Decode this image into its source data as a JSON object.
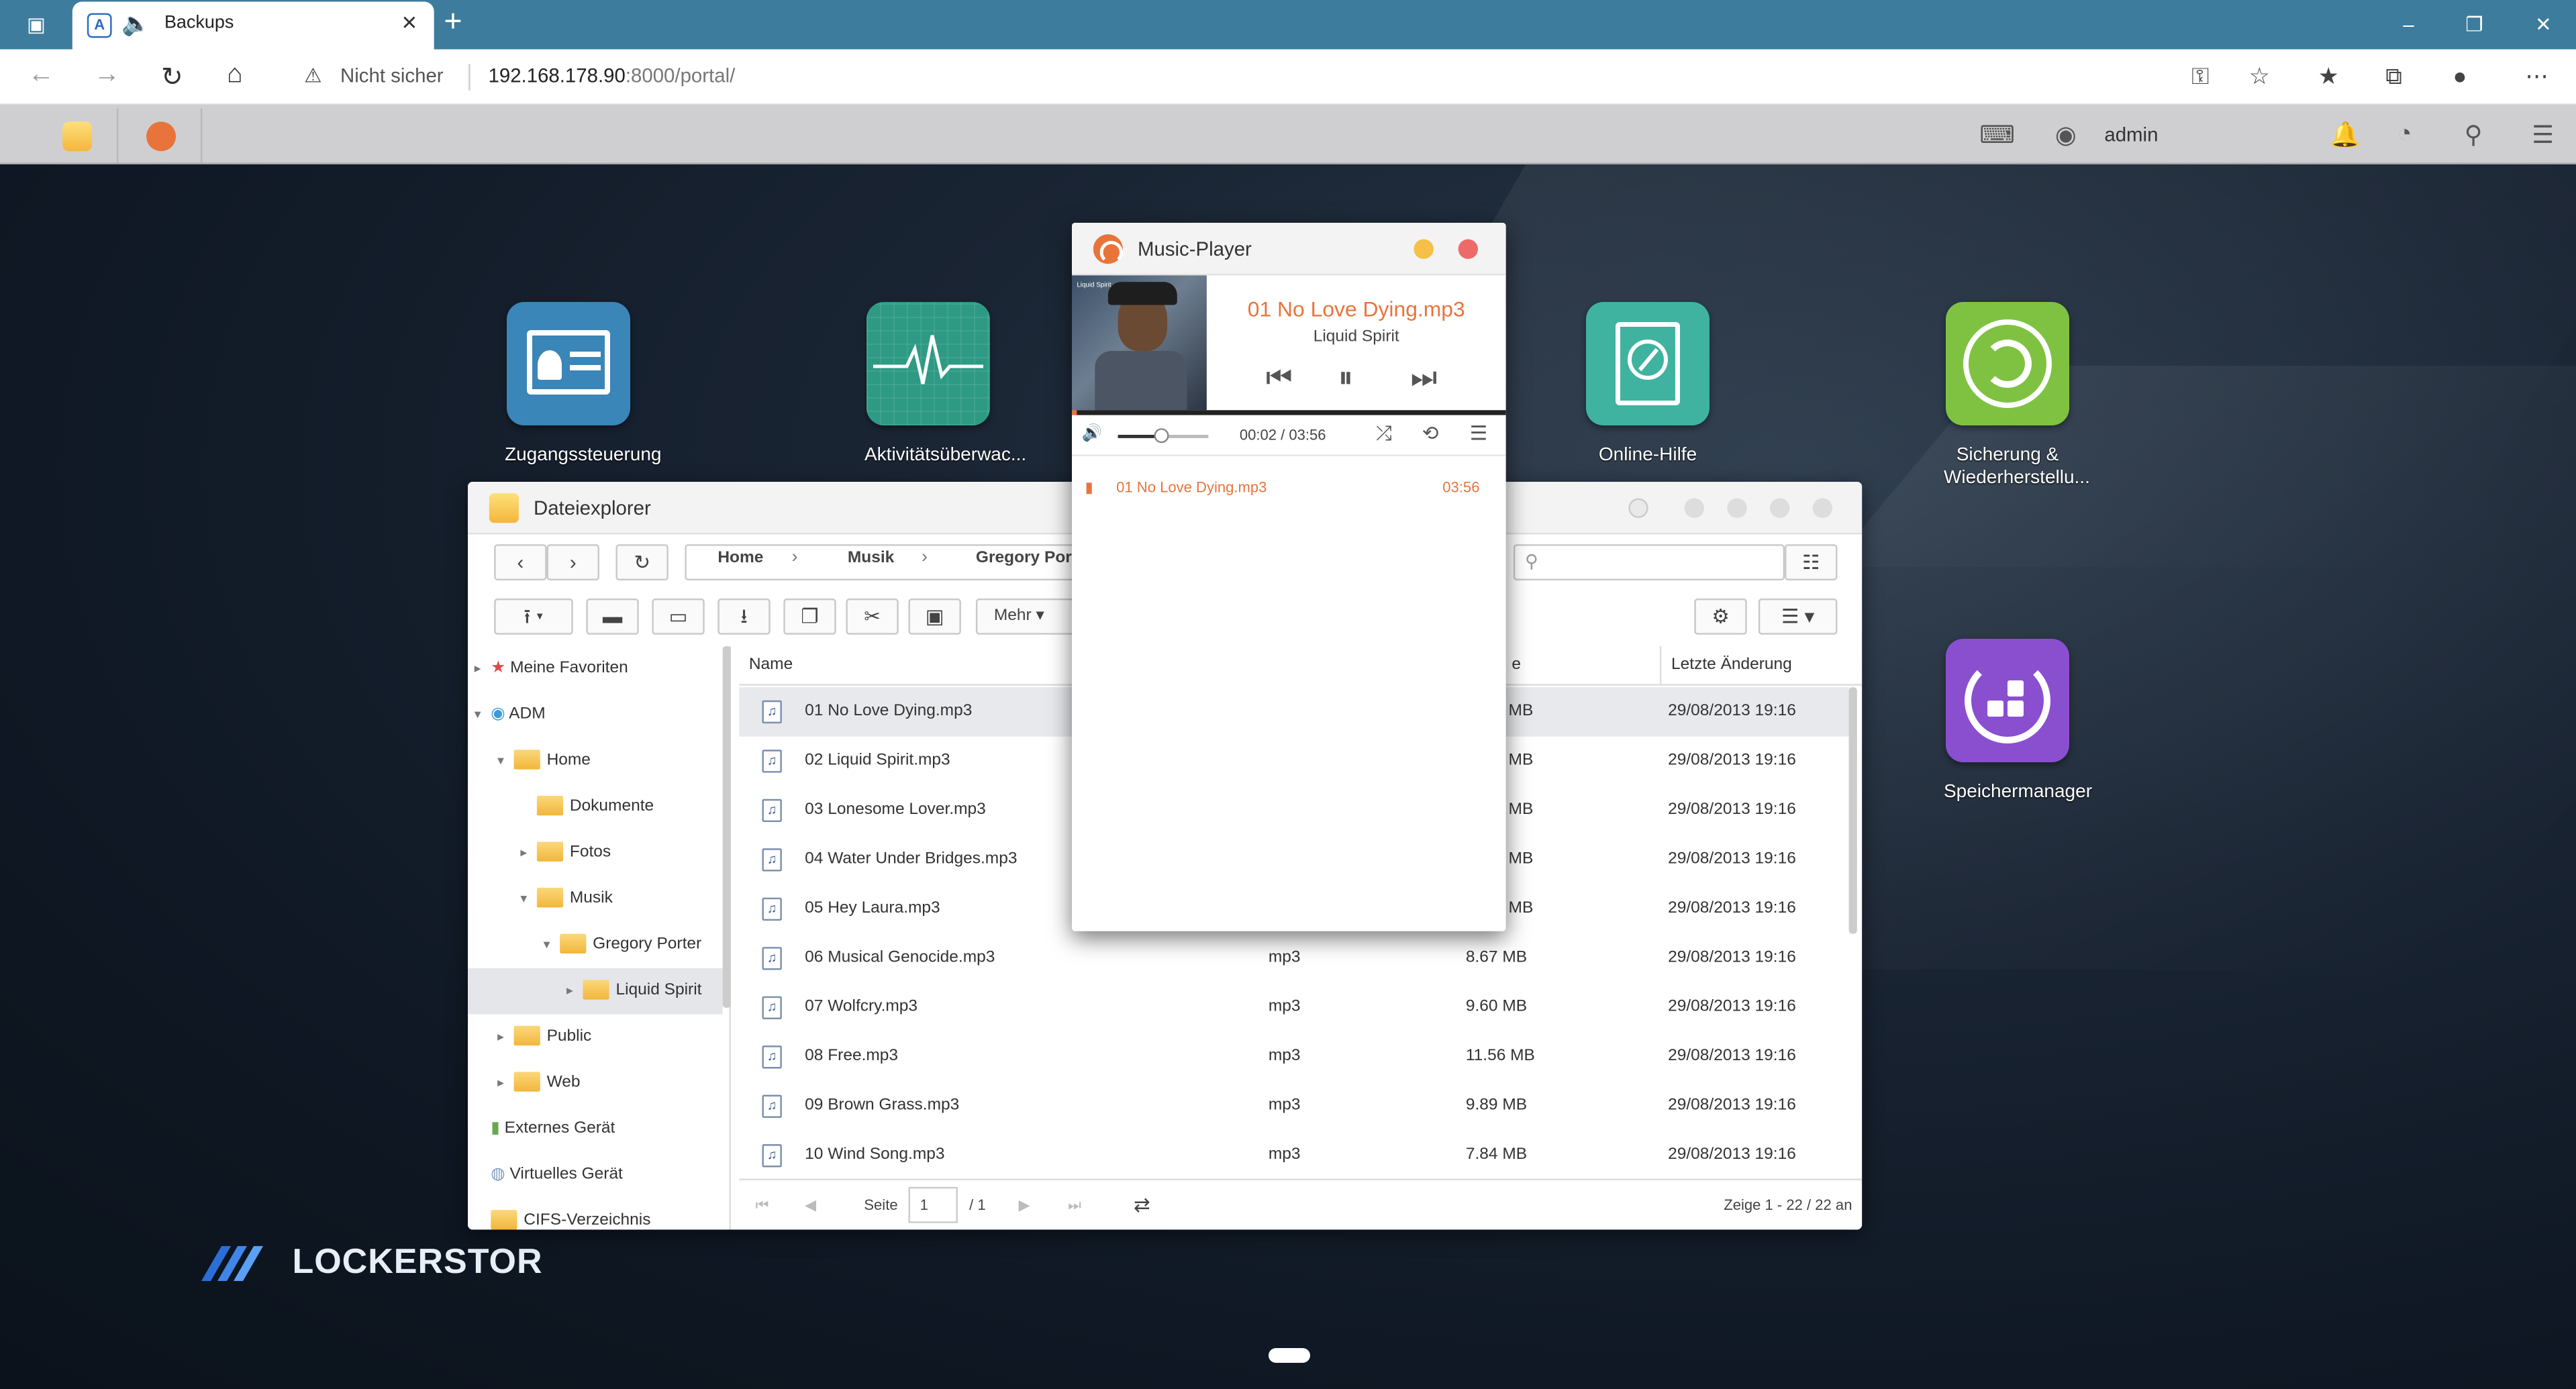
{
  "browser": {
    "tab_title": "Backups",
    "address_warning": "Nicht sicher",
    "url_host": "192.168.178.90",
    "url_rest": ":8000/portal/"
  },
  "adm": {
    "user": "admin"
  },
  "desktop": {
    "icons": [
      {
        "label": "Zugangssteuerung",
        "color": "#3a86b8"
      },
      {
        "label": "Aktivitätsüberwac...",
        "color": "#2e9a83"
      },
      {
        "label": "Online-Hilfe",
        "color": "#3fb3a0"
      },
      {
        "label": "Sicherung & Wiederherstellu...",
        "color": "#7fc241"
      },
      {
        "label": "Speichermanager",
        "color": "#8a4fcf"
      }
    ],
    "brand": "LOCKERSTOR"
  },
  "explorer": {
    "title": "Dateiexplorer",
    "breadcrumbs": [
      "Home",
      "Musik",
      "Gregory Por"
    ],
    "more_label": "Mehr",
    "tree": [
      {
        "label": "Meine Favoriten"
      },
      {
        "label": "ADM"
      },
      {
        "label": "Home"
      },
      {
        "label": "Dokumente"
      },
      {
        "label": "Fotos"
      },
      {
        "label": "Musik"
      },
      {
        "label": "Gregory Porter"
      },
      {
        "label": "Liquid Spirit"
      },
      {
        "label": "Public"
      },
      {
        "label": "Web"
      },
      {
        "label": "Externes Gerät"
      },
      {
        "label": "Virtuelles Gerät"
      },
      {
        "label": "CIFS-Verzeichnis"
      }
    ],
    "columns": {
      "name": "Name",
      "size_partial": "e",
      "modified": "Letzte Änderung"
    },
    "files": [
      {
        "name": "01 No Love Dying.mp3",
        "type": "",
        "size": "MB",
        "modified": "29/08/2013 19:16"
      },
      {
        "name": "02 Liquid Spirit.mp3",
        "type": "",
        "size": "MB",
        "modified": "29/08/2013 19:16"
      },
      {
        "name": "03 Lonesome Lover.mp3",
        "type": "",
        "size": "MB",
        "modified": "29/08/2013 19:16"
      },
      {
        "name": "04 Water Under Bridges.mp3",
        "type": "",
        "size": "MB",
        "modified": "29/08/2013 19:16"
      },
      {
        "name": "05 Hey Laura.mp3",
        "type": "",
        "size": "MB",
        "modified": "29/08/2013 19:16"
      },
      {
        "name": "06 Musical Genocide.mp3",
        "type": "mp3",
        "size": "8.67 MB",
        "modified": "29/08/2013 19:16"
      },
      {
        "name": "07 Wolfcry.mp3",
        "type": "mp3",
        "size": "9.60 MB",
        "modified": "29/08/2013 19:16"
      },
      {
        "name": "08 Free.mp3",
        "type": "mp3",
        "size": "11.56 MB",
        "modified": "29/08/2013 19:16"
      },
      {
        "name": "09 Brown Grass.mp3",
        "type": "mp3",
        "size": "9.89 MB",
        "modified": "29/08/2013 19:16"
      },
      {
        "name": "10 Wind Song.mp3",
        "type": "mp3",
        "size": "7.84 MB",
        "modified": "29/08/2013 19:16"
      }
    ],
    "pager": {
      "page_label": "Seite",
      "page": "1",
      "total": "/ 1",
      "showing": "Zeige 1 - 22 / 22 an"
    }
  },
  "player": {
    "title": "Music-Player",
    "art_label": "Liquid Spirit",
    "song": "01 No Love Dying.mp3",
    "artist": "Liquid Spirit",
    "time": "00:02 / 03:56",
    "progress_fraction": 0.01,
    "volume_fraction": 0.5,
    "playlist": [
      {
        "name": "01 No Love Dying.mp3",
        "duration": "03:56"
      }
    ]
  }
}
